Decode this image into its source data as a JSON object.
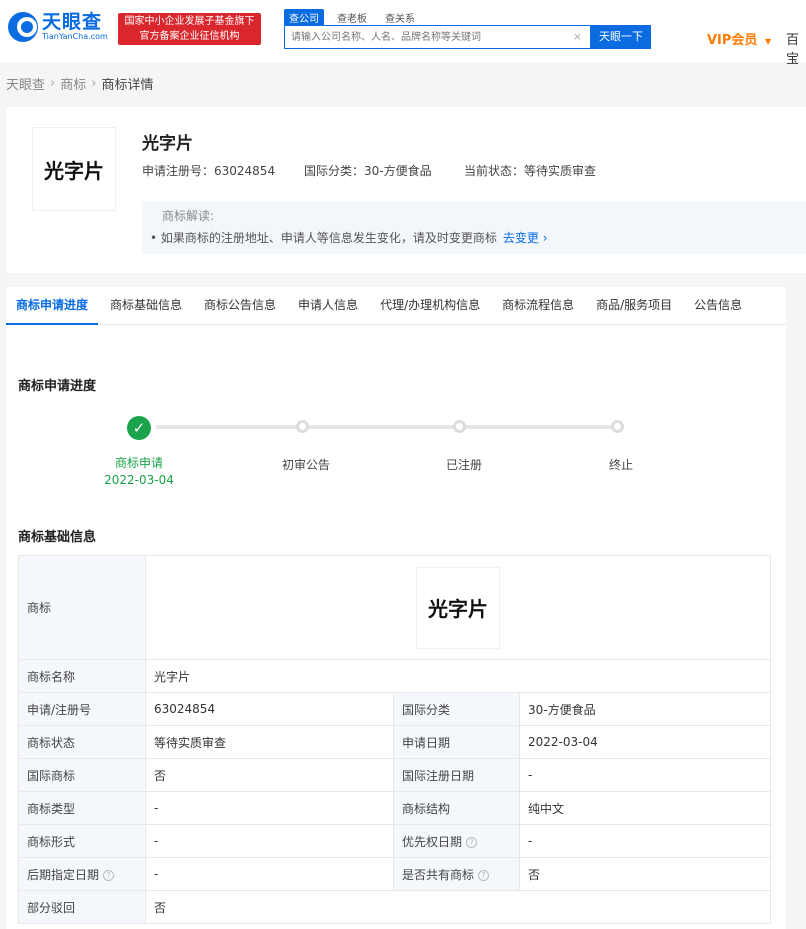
{
  "header": {
    "logo_cn": "天眼查",
    "logo_en": "TianYanCha.com",
    "badge_line1": "国家中小企业发展子基金旗下",
    "badge_line2": "官方备案企业征信机构",
    "search_tabs": [
      "查公司",
      "查老板",
      "查关系"
    ],
    "search_placeholder": "请输入公司名称、人名、品牌名称等关键词",
    "search_button": "天眼一下",
    "vip_label": "VIP会员",
    "more_label": "百宝"
  },
  "breadcrumb": {
    "home": "天眼查",
    "level2": "商标",
    "current": "商标详情"
  },
  "summary": {
    "logo_text": "光字片",
    "title": "光字片",
    "reg_no": "申请注册号：63024854",
    "intl_class": "国际分类：30-方便食品",
    "status": "当前状态：等待实质审查",
    "tip_title": "商标解读:",
    "tip_text": "• 如果商标的注册地址、申请人等信息发生变化，请及时变更商标",
    "tip_link": "去变更"
  },
  "tabs": [
    "商标申请进度",
    "商标基础信息",
    "商标公告信息",
    "申请人信息",
    "代理/办理机构信息",
    "商标流程信息",
    "商品/服务项目",
    "公告信息"
  ],
  "progress": {
    "title": "商标申请进度",
    "steps": [
      {
        "label": "商标申请",
        "date": "2022-03-04",
        "done": true
      },
      {
        "label": "初审公告",
        "date": "",
        "done": false
      },
      {
        "label": "已注册",
        "date": "",
        "done": false
      },
      {
        "label": "终止",
        "date": "",
        "done": false
      }
    ]
  },
  "basic_info": {
    "title": "商标基础信息",
    "logo_label": "商标",
    "logo_text": "光字片",
    "name_label": "商标名称",
    "name_value": "光字片",
    "rows": [
      {
        "l1": "申请/注册号",
        "v1": "63024854",
        "l2": "国际分类",
        "v2": "30-方便食品"
      },
      {
        "l1": "商标状态",
        "v1": "等待实质审查",
        "l2": "申请日期",
        "v2": "2022-03-04"
      },
      {
        "l1": "国际商标",
        "v1": "否",
        "l2": "国际注册日期",
        "v2": "-"
      },
      {
        "l1": "商标类型",
        "v1": "-",
        "l2": "商标结构",
        "v2": "纯中文"
      },
      {
        "l1": "商标形式",
        "v1": "-",
        "l2": "优先权日期",
        "v2": "-"
      },
      {
        "l1": "后期指定日期",
        "v1": "-",
        "l2": "是否共有商标",
        "v2": "否"
      }
    ],
    "partial_label": "部分驳回",
    "partial_value": "否"
  },
  "colors": {
    "brand_blue": "#0a6ce0",
    "badge_red": "#d9272d",
    "vip_orange": "#ff7a00",
    "done_green": "#1aa34a"
  }
}
